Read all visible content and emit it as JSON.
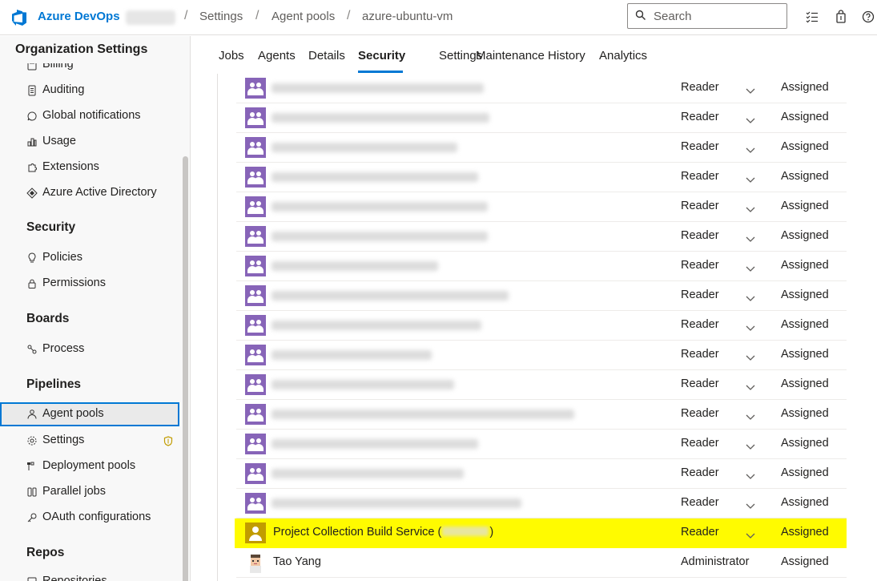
{
  "header": {
    "brand": "Azure DevOps",
    "breadcrumbs": [
      "Settings",
      "Agent pools",
      "azure-ubuntu-vm"
    ],
    "search_placeholder": "Search"
  },
  "sidebar": {
    "title": "Organization Settings",
    "items_top": [
      {
        "label": "Billing",
        "icon": "billing-icon"
      },
      {
        "label": "Auditing",
        "icon": "auditing-icon"
      },
      {
        "label": "Global notifications",
        "icon": "notifications-icon"
      },
      {
        "label": "Usage",
        "icon": "usage-icon"
      },
      {
        "label": "Extensions",
        "icon": "extensions-icon"
      },
      {
        "label": "Azure Active Directory",
        "icon": "aad-icon"
      }
    ],
    "sections": {
      "security": "Security",
      "boards": "Boards",
      "pipelines": "Pipelines",
      "repos": "Repos"
    },
    "security_items": [
      {
        "label": "Policies",
        "icon": "lightbulb-icon"
      },
      {
        "label": "Permissions",
        "icon": "lock-icon"
      }
    ],
    "boards_items": [
      {
        "label": "Process",
        "icon": "process-icon"
      }
    ],
    "pipelines_items": [
      {
        "label": "Agent pools",
        "icon": "agent-pools-icon",
        "selected": true
      },
      {
        "label": "Settings",
        "icon": "gear-icon",
        "badge": "shield-icon"
      },
      {
        "label": "Deployment pools",
        "icon": "deployment-pools-icon"
      },
      {
        "label": "Parallel jobs",
        "icon": "parallel-jobs-icon"
      },
      {
        "label": "OAuth configurations",
        "icon": "key-icon"
      }
    ],
    "repos_items": [
      {
        "label": "Repositories",
        "icon": "repo-icon"
      }
    ]
  },
  "tabs": [
    {
      "label": "Jobs"
    },
    {
      "label": "Agents"
    },
    {
      "label": "Details"
    },
    {
      "label": "Security",
      "active": true
    },
    {
      "label": "Settings"
    },
    {
      "label": "Maintenance History"
    },
    {
      "label": "Analytics"
    }
  ],
  "security_rows": [
    {
      "name": "",
      "role": "Reader",
      "access": "Assigned",
      "avatar": "group-icon"
    },
    {
      "name": "",
      "role": "Reader",
      "access": "Assigned",
      "avatar": "group-icon"
    },
    {
      "name": "",
      "role": "Reader",
      "access": "Assigned",
      "avatar": "group-icon"
    },
    {
      "name": "",
      "role": "Reader",
      "access": "Assigned",
      "avatar": "group-icon"
    },
    {
      "name": "",
      "role": "Reader",
      "access": "Assigned",
      "avatar": "group-icon"
    },
    {
      "name": "",
      "role": "Reader",
      "access": "Assigned",
      "avatar": "group-icon"
    },
    {
      "name": "",
      "role": "Reader",
      "access": "Assigned",
      "avatar": "group-icon"
    },
    {
      "name": "",
      "role": "Reader",
      "access": "Assigned",
      "avatar": "group-icon"
    },
    {
      "name": "",
      "role": "Reader",
      "access": "Assigned",
      "avatar": "group-icon"
    },
    {
      "name": "",
      "role": "Reader",
      "access": "Assigned",
      "avatar": "group-icon"
    },
    {
      "name": "",
      "role": "Reader",
      "access": "Assigned",
      "avatar": "group-icon"
    },
    {
      "name": "",
      "role": "Reader",
      "access": "Assigned",
      "avatar": "group-icon"
    },
    {
      "name": "",
      "role": "Reader",
      "access": "Assigned",
      "avatar": "group-icon"
    },
    {
      "name": "",
      "role": "Reader",
      "access": "Assigned",
      "avatar": "group-icon"
    },
    {
      "name": "",
      "role": "Reader",
      "access": "Assigned",
      "avatar": "group-icon"
    },
    {
      "name": "Project Collection Build Service (",
      "name_suffix": ")",
      "role": "Reader",
      "access": "Assigned",
      "avatar": "service-icon",
      "highlighted": true
    },
    {
      "name": "Tao Yang",
      "role": "Administrator",
      "access": "Assigned",
      "avatar": "user-avatar"
    }
  ],
  "colors": {
    "accent": "#0078d4",
    "group_avatar": "#8764b8",
    "highlight": "#fffb00",
    "service_avatar": "#c19c00"
  }
}
